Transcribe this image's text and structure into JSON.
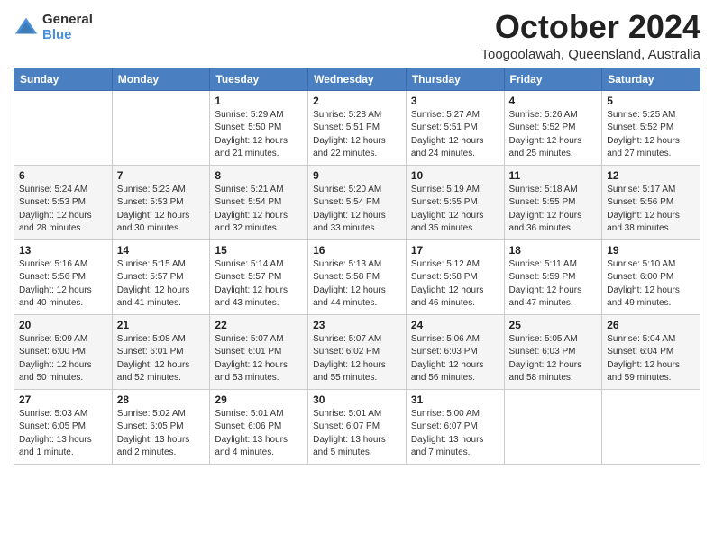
{
  "header": {
    "logo_general": "General",
    "logo_blue": "Blue",
    "month_title": "October 2024",
    "location": "Toogoolawah, Queensland, Australia"
  },
  "days_of_week": [
    "Sunday",
    "Monday",
    "Tuesday",
    "Wednesday",
    "Thursday",
    "Friday",
    "Saturday"
  ],
  "weeks": [
    [
      {
        "day": "",
        "info": ""
      },
      {
        "day": "",
        "info": ""
      },
      {
        "day": "1",
        "info": "Sunrise: 5:29 AM\nSunset: 5:50 PM\nDaylight: 12 hours and 21 minutes."
      },
      {
        "day": "2",
        "info": "Sunrise: 5:28 AM\nSunset: 5:51 PM\nDaylight: 12 hours and 22 minutes."
      },
      {
        "day": "3",
        "info": "Sunrise: 5:27 AM\nSunset: 5:51 PM\nDaylight: 12 hours and 24 minutes."
      },
      {
        "day": "4",
        "info": "Sunrise: 5:26 AM\nSunset: 5:52 PM\nDaylight: 12 hours and 25 minutes."
      },
      {
        "day": "5",
        "info": "Sunrise: 5:25 AM\nSunset: 5:52 PM\nDaylight: 12 hours and 27 minutes."
      }
    ],
    [
      {
        "day": "6",
        "info": "Sunrise: 5:24 AM\nSunset: 5:53 PM\nDaylight: 12 hours and 28 minutes."
      },
      {
        "day": "7",
        "info": "Sunrise: 5:23 AM\nSunset: 5:53 PM\nDaylight: 12 hours and 30 minutes."
      },
      {
        "day": "8",
        "info": "Sunrise: 5:21 AM\nSunset: 5:54 PM\nDaylight: 12 hours and 32 minutes."
      },
      {
        "day": "9",
        "info": "Sunrise: 5:20 AM\nSunset: 5:54 PM\nDaylight: 12 hours and 33 minutes."
      },
      {
        "day": "10",
        "info": "Sunrise: 5:19 AM\nSunset: 5:55 PM\nDaylight: 12 hours and 35 minutes."
      },
      {
        "day": "11",
        "info": "Sunrise: 5:18 AM\nSunset: 5:55 PM\nDaylight: 12 hours and 36 minutes."
      },
      {
        "day": "12",
        "info": "Sunrise: 5:17 AM\nSunset: 5:56 PM\nDaylight: 12 hours and 38 minutes."
      }
    ],
    [
      {
        "day": "13",
        "info": "Sunrise: 5:16 AM\nSunset: 5:56 PM\nDaylight: 12 hours and 40 minutes."
      },
      {
        "day": "14",
        "info": "Sunrise: 5:15 AM\nSunset: 5:57 PM\nDaylight: 12 hours and 41 minutes."
      },
      {
        "day": "15",
        "info": "Sunrise: 5:14 AM\nSunset: 5:57 PM\nDaylight: 12 hours and 43 minutes."
      },
      {
        "day": "16",
        "info": "Sunrise: 5:13 AM\nSunset: 5:58 PM\nDaylight: 12 hours and 44 minutes."
      },
      {
        "day": "17",
        "info": "Sunrise: 5:12 AM\nSunset: 5:58 PM\nDaylight: 12 hours and 46 minutes."
      },
      {
        "day": "18",
        "info": "Sunrise: 5:11 AM\nSunset: 5:59 PM\nDaylight: 12 hours and 47 minutes."
      },
      {
        "day": "19",
        "info": "Sunrise: 5:10 AM\nSunset: 6:00 PM\nDaylight: 12 hours and 49 minutes."
      }
    ],
    [
      {
        "day": "20",
        "info": "Sunrise: 5:09 AM\nSunset: 6:00 PM\nDaylight: 12 hours and 50 minutes."
      },
      {
        "day": "21",
        "info": "Sunrise: 5:08 AM\nSunset: 6:01 PM\nDaylight: 12 hours and 52 minutes."
      },
      {
        "day": "22",
        "info": "Sunrise: 5:07 AM\nSunset: 6:01 PM\nDaylight: 12 hours and 53 minutes."
      },
      {
        "day": "23",
        "info": "Sunrise: 5:07 AM\nSunset: 6:02 PM\nDaylight: 12 hours and 55 minutes."
      },
      {
        "day": "24",
        "info": "Sunrise: 5:06 AM\nSunset: 6:03 PM\nDaylight: 12 hours and 56 minutes."
      },
      {
        "day": "25",
        "info": "Sunrise: 5:05 AM\nSunset: 6:03 PM\nDaylight: 12 hours and 58 minutes."
      },
      {
        "day": "26",
        "info": "Sunrise: 5:04 AM\nSunset: 6:04 PM\nDaylight: 12 hours and 59 minutes."
      }
    ],
    [
      {
        "day": "27",
        "info": "Sunrise: 5:03 AM\nSunset: 6:05 PM\nDaylight: 13 hours and 1 minute."
      },
      {
        "day": "28",
        "info": "Sunrise: 5:02 AM\nSunset: 6:05 PM\nDaylight: 13 hours and 2 minutes."
      },
      {
        "day": "29",
        "info": "Sunrise: 5:01 AM\nSunset: 6:06 PM\nDaylight: 13 hours and 4 minutes."
      },
      {
        "day": "30",
        "info": "Sunrise: 5:01 AM\nSunset: 6:07 PM\nDaylight: 13 hours and 5 minutes."
      },
      {
        "day": "31",
        "info": "Sunrise: 5:00 AM\nSunset: 6:07 PM\nDaylight: 13 hours and 7 minutes."
      },
      {
        "day": "",
        "info": ""
      },
      {
        "day": "",
        "info": ""
      }
    ]
  ]
}
